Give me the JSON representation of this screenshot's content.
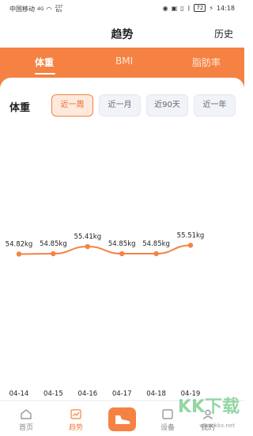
{
  "status_bar": {
    "carrier": "中国移动",
    "signal": "4G",
    "speed": "237 B/s",
    "battery": "72",
    "time": "14:18"
  },
  "header": {
    "title": "趋势",
    "history_label": "历史"
  },
  "top_tabs": [
    {
      "label": "体重",
      "active": true
    },
    {
      "label": "BMI",
      "active": false
    },
    {
      "label": "脂肪率",
      "active": false
    }
  ],
  "section_title": "体重",
  "ranges": [
    {
      "label": "近一周",
      "active": true
    },
    {
      "label": "近一月",
      "active": false
    },
    {
      "label": "近90天",
      "active": false
    },
    {
      "label": "近一年",
      "active": false
    }
  ],
  "chart_data": {
    "type": "line",
    "x": [
      "04-14",
      "04-15",
      "04-16",
      "04-17",
      "04-18",
      "04-19"
    ],
    "series": [
      {
        "values": [
          54.82,
          54.85,
          55.41,
          54.85,
          54.85,
          55.51
        ],
        "labels": [
          "54.82kg",
          "54.85kg",
          "55.41kg",
          "54.85kg",
          "54.85kg",
          "55.51kg"
        ]
      }
    ],
    "color": "#f58242"
  },
  "bottom_nav": [
    {
      "label": "首页",
      "active": false,
      "icon": "home-icon"
    },
    {
      "label": "趋势",
      "active": true,
      "icon": "trend-icon"
    },
    {
      "label": "",
      "active": false,
      "icon": "shoe-icon"
    },
    {
      "label": "设备",
      "active": false,
      "icon": "device-icon"
    },
    {
      "label": "我的",
      "active": false,
      "icon": "profile-icon"
    }
  ],
  "watermark": {
    "text": "KK下载",
    "url": "www.kkx.net"
  },
  "colors": {
    "accent": "#f58242",
    "accent_light": "#fde9dd",
    "chip_bg": "#f0f3f8"
  }
}
